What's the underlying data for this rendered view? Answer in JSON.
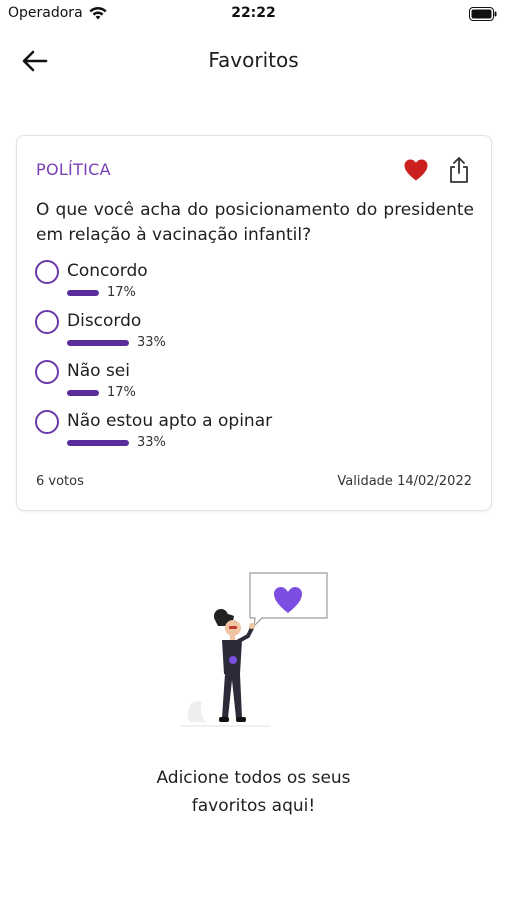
{
  "status_bar": {
    "carrier": "Operadora",
    "time": "22:22",
    "icons": [
      "wifi-icon",
      "battery-icon"
    ]
  },
  "nav": {
    "back_icon": "arrow-left-icon",
    "title": "Favoritos"
  },
  "poll": {
    "category": "POLÍTICA",
    "favorite_icon": "heart-icon",
    "share_icon": "share-icon",
    "question": "O que você acha do posicionamento do presidente em relação à vacinação infantil?",
    "options": [
      {
        "label": "Concordo",
        "percent_text": "17%",
        "fraction": 0.17
      },
      {
        "label": "Discordo",
        "percent_text": "33%",
        "fraction": 0.33
      },
      {
        "label": "Não sei",
        "percent_text": "17%",
        "fraction": 0.17
      },
      {
        "label": "Não estou apto a opinar",
        "percent_text": "33%",
        "fraction": 0.33
      }
    ],
    "votes": "6 votos",
    "validity": "Validade 14/02/2022"
  },
  "empty_state": {
    "illustration_icon": "woman-with-heart-bubble-illustration",
    "line1": "Adicione todos os seus",
    "line2": "favoritos aqui!"
  },
  "colors": {
    "accent": "#6a3aa7",
    "category": "#7a3fb8",
    "bar": "#5a2e9a",
    "heart": "#cc1f1f",
    "illustration_heart": "#7b4de0"
  }
}
